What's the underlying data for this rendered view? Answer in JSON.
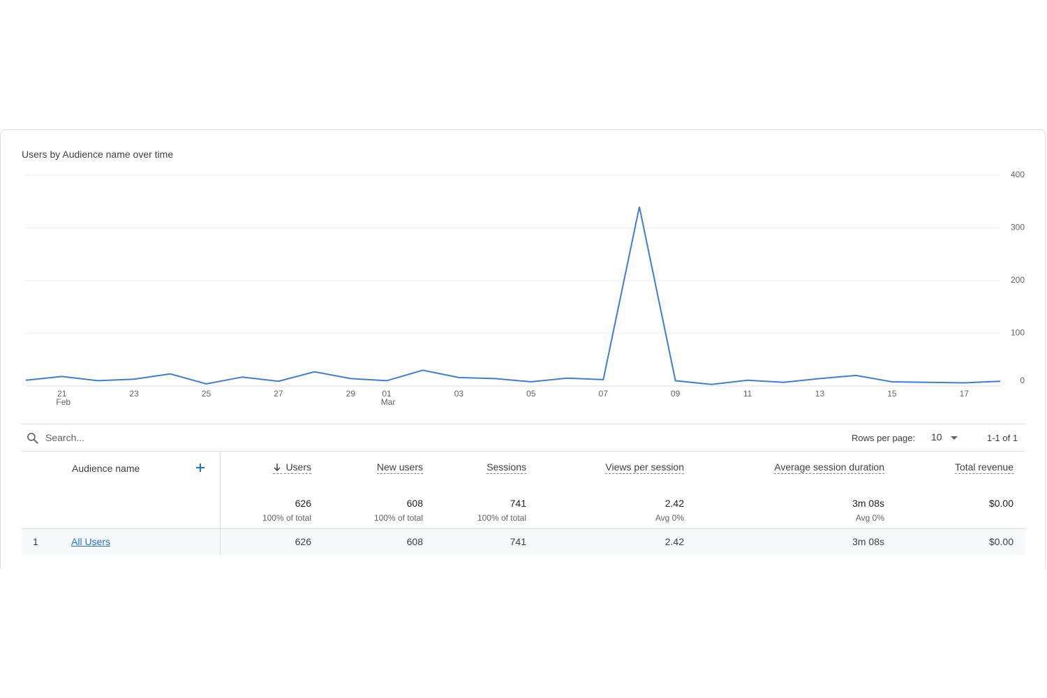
{
  "chart_title": "Users by Audience name over time",
  "chart_data": {
    "type": "line",
    "title": "Users by Audience name over time",
    "xlabel": "",
    "ylabel": "",
    "x": [
      "2024-02-20",
      "2024-02-21",
      "2024-02-22",
      "2024-02-23",
      "2024-02-24",
      "2024-02-25",
      "2024-02-26",
      "2024-02-27",
      "2024-02-28",
      "2024-02-29",
      "2024-03-01",
      "2024-03-02",
      "2024-03-03",
      "2024-03-04",
      "2024-03-05",
      "2024-03-06",
      "2024-03-07",
      "2024-03-08",
      "2024-03-09",
      "2024-03-10",
      "2024-03-11",
      "2024-03-12",
      "2024-03-13",
      "2024-03-14",
      "2024-03-15",
      "2024-03-16",
      "2024-03-17",
      "2024-03-18"
    ],
    "series": [
      {
        "values": [
          11,
          18,
          10,
          13,
          23,
          4,
          17,
          9,
          27,
          14,
          10,
          30,
          16,
          14,
          8,
          15,
          12,
          340,
          10,
          3,
          11,
          7,
          14,
          20,
          8,
          7,
          6,
          9
        ]
      }
    ],
    "x_ticks": [
      {
        "day": "21",
        "month": "Feb",
        "index": 1
      },
      {
        "day": "23",
        "month": "",
        "index": 3
      },
      {
        "day": "25",
        "month": "",
        "index": 5
      },
      {
        "day": "27",
        "month": "",
        "index": 7
      },
      {
        "day": "29",
        "month": "",
        "index": 9
      },
      {
        "day": "01",
        "month": "Mar",
        "index": 10
      },
      {
        "day": "03",
        "month": "",
        "index": 12
      },
      {
        "day": "05",
        "month": "",
        "index": 14
      },
      {
        "day": "07",
        "month": "",
        "index": 16
      },
      {
        "day": "09",
        "month": "",
        "index": 18
      },
      {
        "day": "11",
        "month": "",
        "index": 20
      },
      {
        "day": "13",
        "month": "",
        "index": 22
      },
      {
        "day": "15",
        "month": "",
        "index": 24
      },
      {
        "day": "17",
        "month": "",
        "index": 26
      }
    ],
    "y_ticks": [
      0,
      100,
      200,
      300,
      400
    ],
    "ylim": [
      0,
      400
    ],
    "y_axis_side": "right",
    "grid": true,
    "line_color": "#3b7dd8"
  },
  "search": {
    "placeholder": "Search..."
  },
  "pagination": {
    "rows_label": "Rows per page:",
    "rows_value": "10",
    "range": "1-1 of 1"
  },
  "table": {
    "dimension_label": "Audience name",
    "columns": [
      {
        "key": "users",
        "label": "Users",
        "total": "626",
        "sub": "100% of total",
        "row": "626"
      },
      {
        "key": "new_users",
        "label": "New users",
        "total": "608",
        "sub": "100% of total",
        "row": "608"
      },
      {
        "key": "sessions",
        "label": "Sessions",
        "total": "741",
        "sub": "100% of total",
        "row": "741"
      },
      {
        "key": "views_per_session",
        "label": "Views per session",
        "total": "2.42",
        "sub": "Avg 0%",
        "row": "2.42"
      },
      {
        "key": "avg_session_duration",
        "label": "Average session duration",
        "total": "3m 08s",
        "sub": "Avg 0%",
        "row": "3m 08s"
      },
      {
        "key": "total_revenue",
        "label": "Total revenue",
        "total": "$0.00",
        "sub": "",
        "row": "$0.00"
      }
    ],
    "rows": [
      {
        "index": "1",
        "name": "All Users"
      }
    ]
  }
}
